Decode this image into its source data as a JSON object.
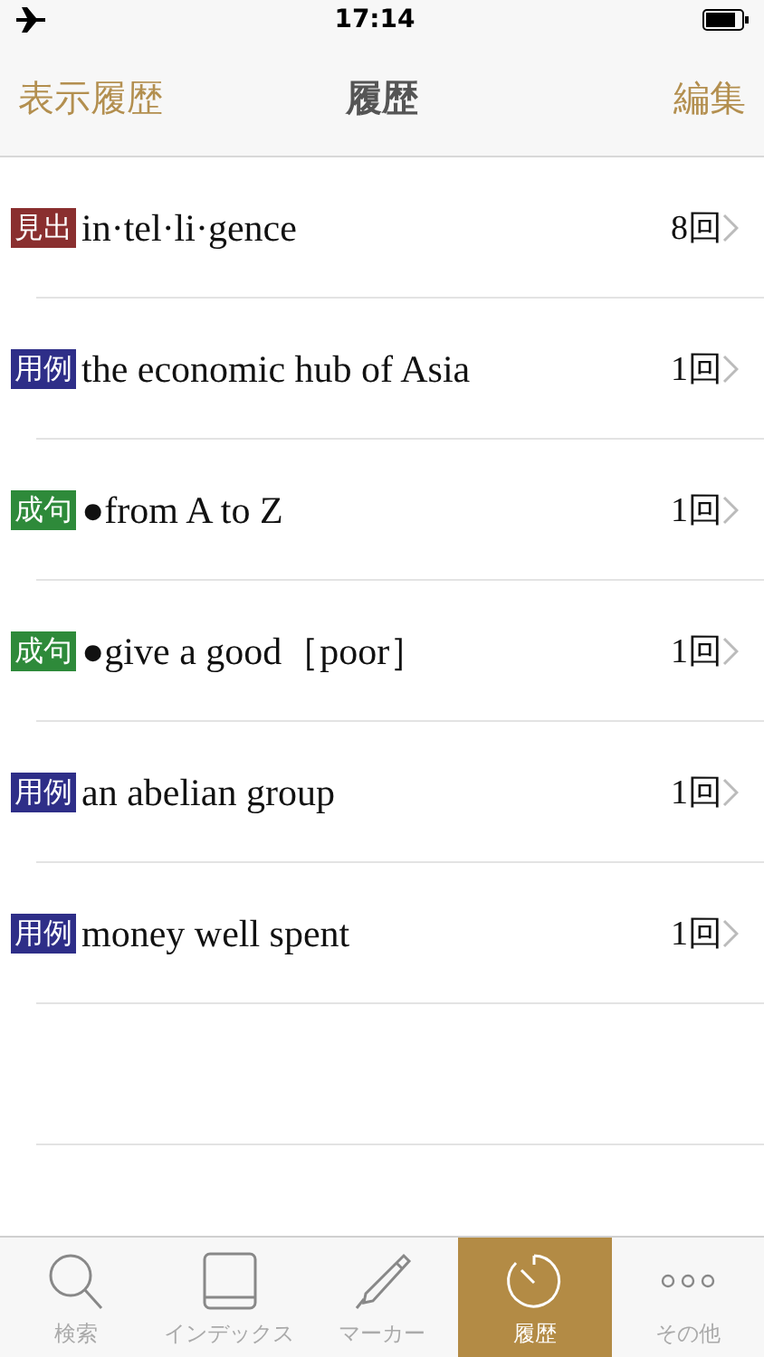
{
  "status_bar": {
    "time": "17:14"
  },
  "nav": {
    "left": "表示履歴",
    "title": "履歴",
    "right": "編集"
  },
  "entries": [
    {
      "tag": "見出",
      "color": "#8a2f2f",
      "text": "in·tel·li·gence",
      "count": "8回"
    },
    {
      "tag": "用例",
      "color": "#2e2e88",
      "text": "the economic hub of Asia",
      "count": "1回"
    },
    {
      "tag": "成句",
      "color": "#2e8a3a",
      "text": "●from A to Z",
      "count": "1回"
    },
    {
      "tag": "成句",
      "color": "#2e8a3a",
      "text": "●give a good［poor］",
      "count": "1回"
    },
    {
      "tag": "用例",
      "color": "#2e2e88",
      "text": "an abelian group",
      "count": "1回"
    },
    {
      "tag": "用例",
      "color": "#2e2e88",
      "text": "money well spent",
      "count": "1回"
    }
  ],
  "tabs": [
    {
      "kind": "search",
      "label": "検索",
      "selected": false
    },
    {
      "kind": "index",
      "label": "インデックス",
      "selected": false
    },
    {
      "kind": "marker",
      "label": "マーカー",
      "selected": false
    },
    {
      "kind": "history",
      "label": "履歴",
      "selected": true
    },
    {
      "kind": "more",
      "label": "その他",
      "selected": false
    }
  ]
}
